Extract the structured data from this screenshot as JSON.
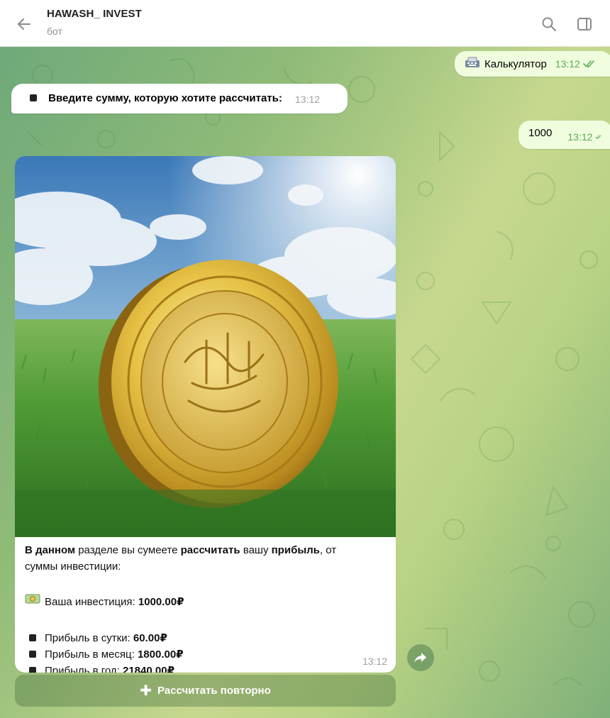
{
  "header": {
    "title": "HAWASH_ INVEST",
    "subtitle": "бот"
  },
  "messages": {
    "calc_out": {
      "text": "Калькулятор",
      "icon": "keyboard-icon",
      "time": "13:12"
    },
    "prompt_in": {
      "text": "Введите сумму, которую хотите рассчитать:",
      "time": "13:12"
    },
    "amount_out": {
      "text": "1000",
      "time": "13:12"
    }
  },
  "result": {
    "intro": {
      "p1": "В данном",
      "p2": " разделе вы сумеете ",
      "p3": "рассчитать",
      "p4": " вашу ",
      "p5": "прибыль",
      "p6": ", от",
      "line2": "суммы инвестиции:"
    },
    "investment": {
      "label": "Ваша инвестиция: ",
      "value": "1000.00₽",
      "icon": "money-icon"
    },
    "profit_day": {
      "label": "Прибыль в сутки: ",
      "value": "60.00₽"
    },
    "profit_month": {
      "label": "Прибыль в месяц: ",
      "value": "1800.00₽"
    },
    "profit_year": {
      "label": "Прибыль в год: ",
      "value": "21840.00₽"
    },
    "time": "13:12"
  },
  "inline_button": {
    "label": "Рассчитать повторно",
    "icon": "plus-icon"
  },
  "colors": {
    "outgoing_bubble": "#effdde",
    "incoming_bubble": "#ffffff",
    "outgoing_time": "#5ca853",
    "chat_bg_start": "#6fa97a",
    "chat_bg_end": "#c7d88e"
  }
}
